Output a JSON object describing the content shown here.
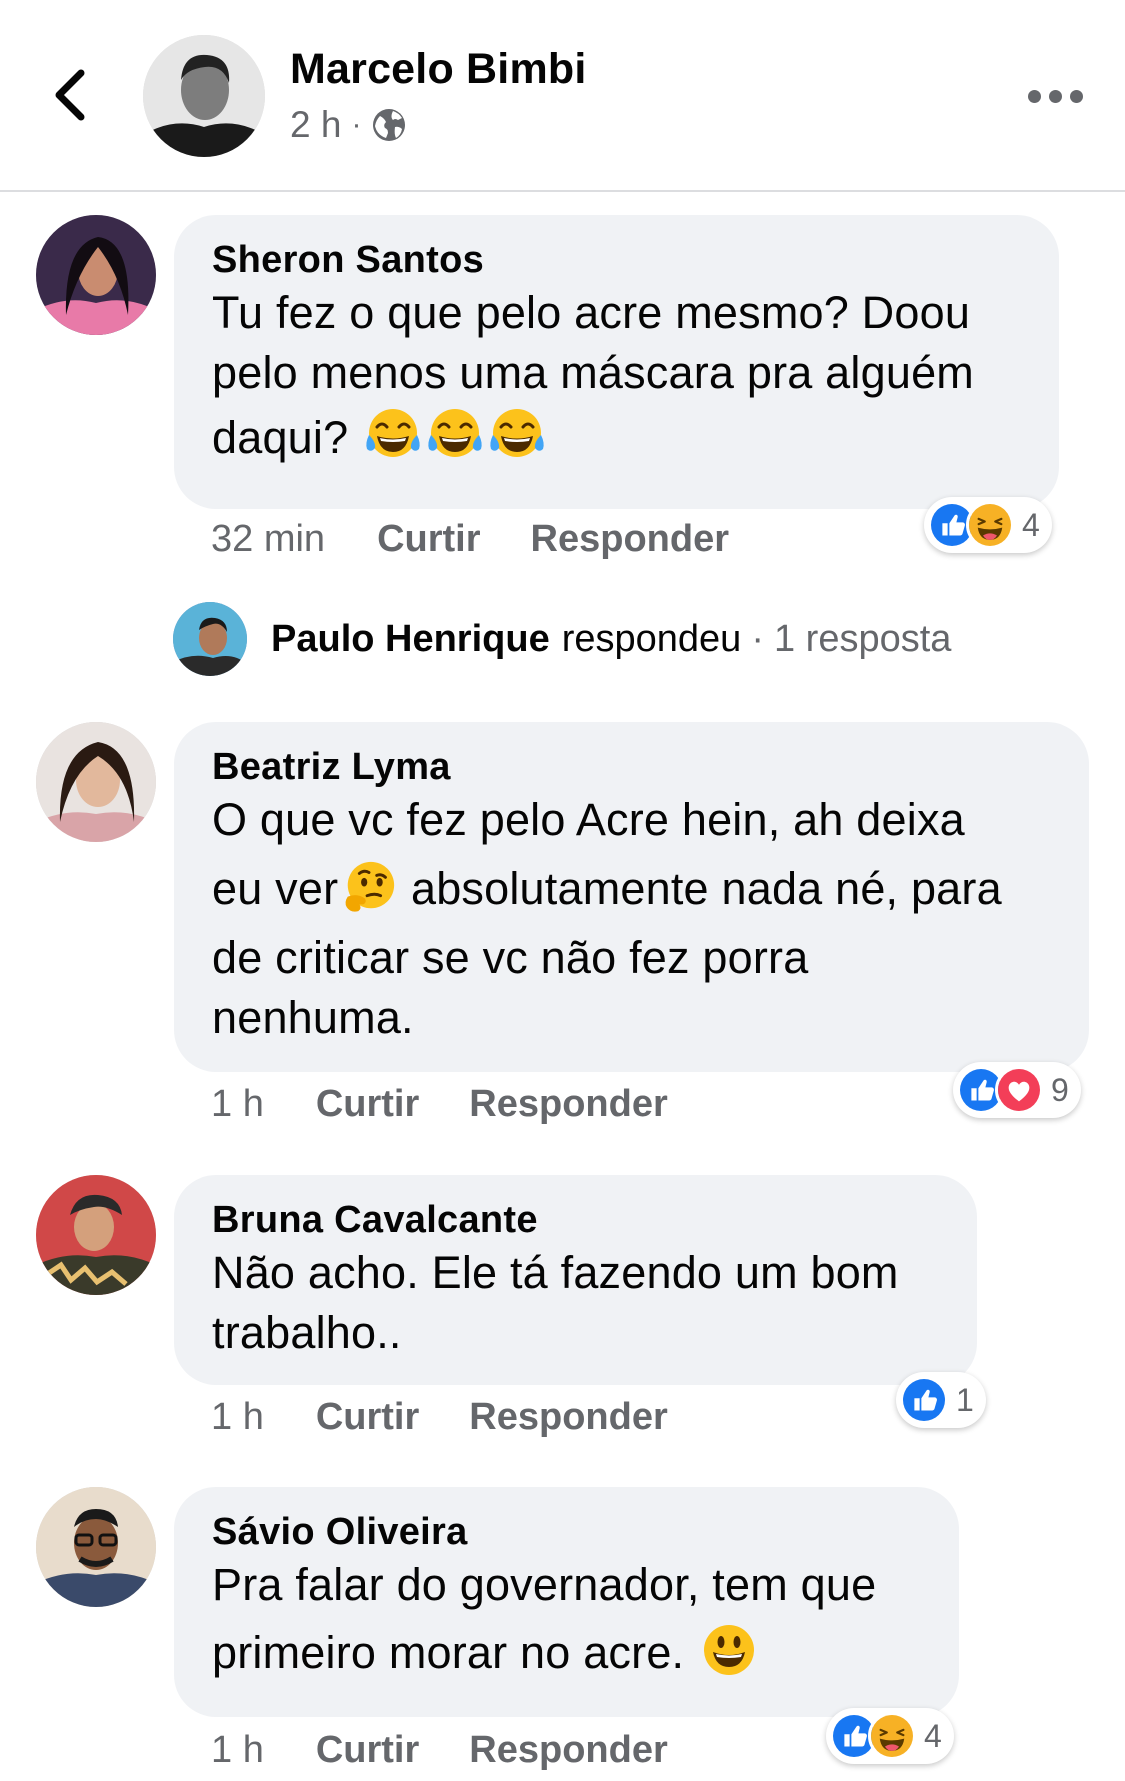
{
  "header": {
    "name": "Marcelo Bimbi",
    "time": "2 h",
    "separator": "·"
  },
  "actions": {
    "like": "Curtir",
    "reply": "Responder"
  },
  "colors": {
    "like_blue": "#1877f2",
    "love_red": "#f33e58",
    "haha_yellow": "#f7b125",
    "bubble_bg": "#f0f2f5",
    "secondary_text": "#65676b"
  },
  "comments": [
    {
      "author": "Sheron Santos",
      "text_lines": [
        "Tu fez o que pelo acre mesmo? Doou",
        "pelo menos uma máscara pra alguém",
        "daqui?"
      ],
      "emojis": [
        "face-with-tears-of-joy",
        "face-with-tears-of-joy",
        "face-with-tears-of-joy"
      ],
      "time": "32 min",
      "reactions": [
        "like",
        "haha"
      ],
      "reaction_count": "4"
    },
    {
      "author": "Beatriz Lyma",
      "text_lines": [
        "O que vc fez pelo Acre hein, ah deixa",
        "eu ver",
        " absolutamente nada né, para",
        "de criticar se vc não fez porra",
        "nenhuma."
      ],
      "emojis": [
        "thinking-face"
      ],
      "time": "1 h",
      "reactions": [
        "like",
        "love"
      ],
      "reaction_count": "9"
    },
    {
      "author": "Bruna Cavalcante",
      "text_lines": [
        "Não acho. Ele tá fazendo um bom",
        "trabalho.."
      ],
      "time": "1 h",
      "reactions": [
        "like"
      ],
      "reaction_count": "1"
    },
    {
      "author": "Sávio Oliveira",
      "text_lines": [
        "Pra falar do governador, tem que",
        "primeiro morar no acre."
      ],
      "emojis": [
        "smiling-face"
      ],
      "time": "1 h",
      "reactions": [
        "like",
        "haha"
      ],
      "reaction_count": "4"
    }
  ],
  "reply_summary": {
    "name": "Paulo Henrique",
    "verb": "respondeu",
    "separator": "·",
    "count": "1 resposta"
  }
}
